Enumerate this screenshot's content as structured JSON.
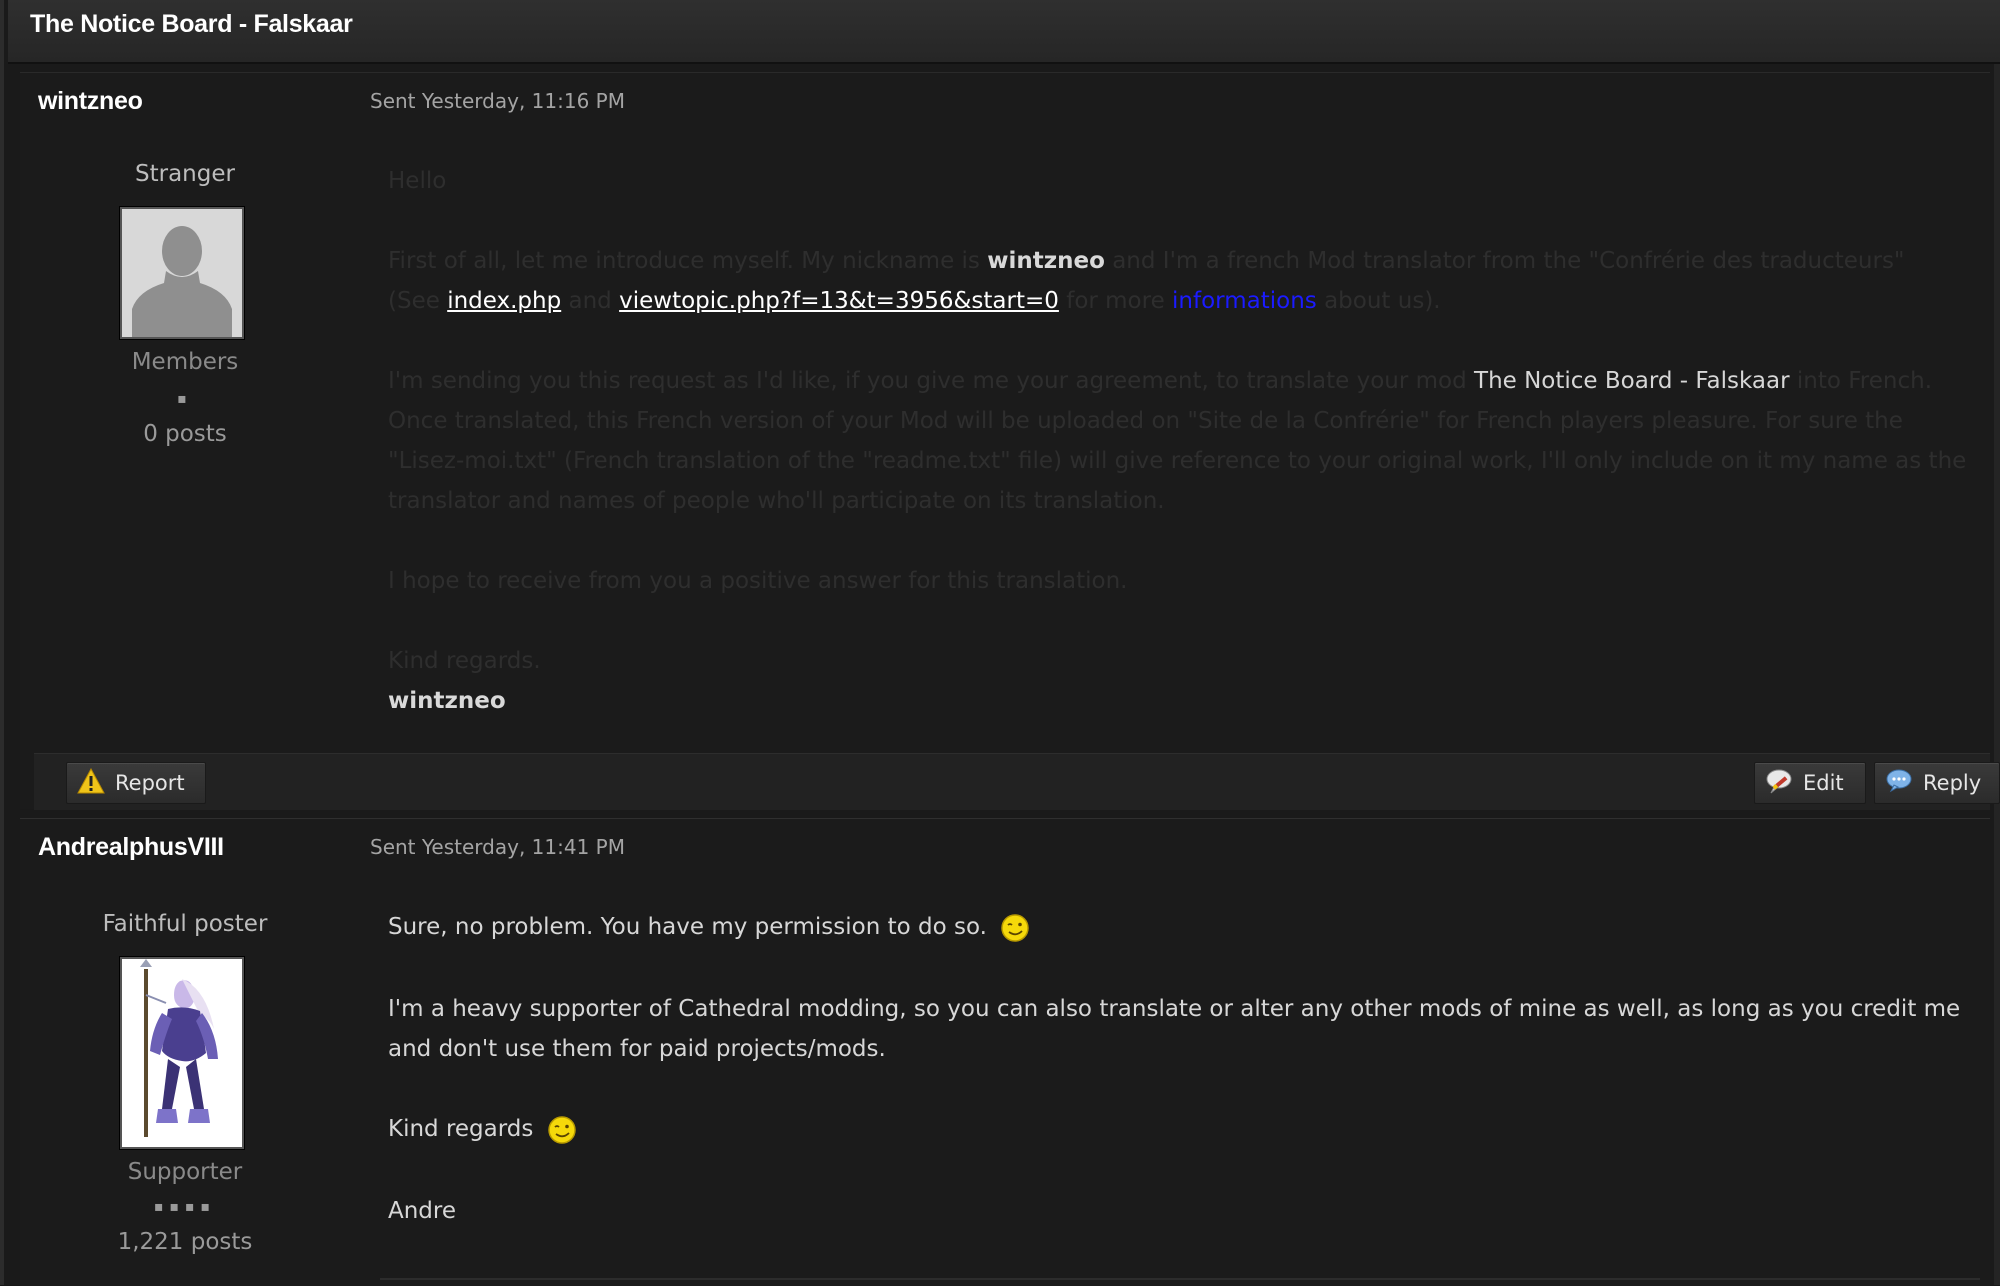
{
  "window": {
    "title": "The Notice Board - Falskaar"
  },
  "posts": [
    {
      "author": "wintzneo",
      "sent": "Sent Yesterday, 11:16 PM",
      "rank": "Stranger",
      "group": "Members",
      "pips": "▪",
      "post_count": "0 posts",
      "body": {
        "hello": "Hello",
        "intro_a": "First of all, let me introduce myself. My nickname is ",
        "intro_name": "wintzneo",
        "intro_b": " and I'm a french Mod translator from the \"Confrérie des traducteurs\"",
        "see_a": "(See ",
        "link1": "index.php",
        "see_and": " and ",
        "link2": "viewtopic.php?f=13&t=3956&start=0",
        "see_for": " for more ",
        "link3": "informations",
        "see_end": " about us).",
        "req_a": "I'm sending you this request as I'd like, if you give me your agreement, to translate your mod ",
        "req_mod": "The Notice Board - Falskaar",
        "req_b": " into French. Once translated, this French version of your Mod will be uploaded on \"Site de la Confrérie\" for French players pleasure. For sure the \"Lisez-moi.txt\" (French translation of the \"readme.txt\" file) will give reference to your original work, I'll only include on it my name as the translator and names of people who'll participate on its translation.",
        "hope": "I hope to receive from you a positive answer for this translation.",
        "regards": "Kind regards.",
        "signature": "wintzneo"
      },
      "actions": {
        "report": "Report",
        "edit": "Edit",
        "reply": "Reply"
      }
    },
    {
      "author": "AndrealphusVIII",
      "sent": "Sent Yesterday, 11:41 PM",
      "rank": "Faithful poster",
      "group": "Supporter",
      "pips": "▪▪▪▪",
      "post_count": "1,221 posts",
      "body": {
        "p1": "Sure, no problem. You have my permission to do so.",
        "p2": "I'm a heavy supporter of Cathedral modding, so you can also translate or alter any other mods of mine as well, as long as you credit me and don't use them for paid projects/mods.",
        "p3": "Kind regards",
        "p4": "Andre"
      }
    }
  ],
  "icons": {
    "report": "warning-icon",
    "edit": "edit-comment-icon",
    "reply": "reply-bubble-icon",
    "smiley": "wink-smiley-icon"
  },
  "colors": {
    "link_blue": "#1b1bff",
    "background": "#1b1b1b",
    "text": "#d7d7d7"
  }
}
